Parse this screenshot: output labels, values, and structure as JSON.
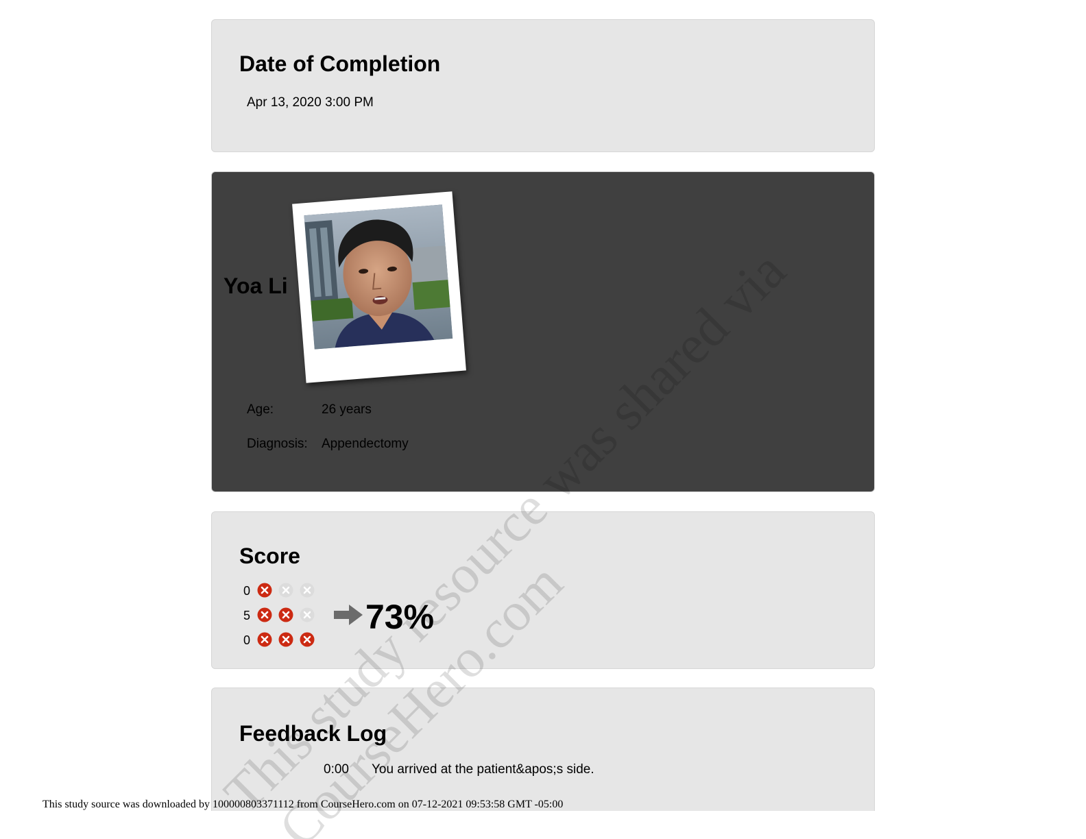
{
  "completion": {
    "title": "Date of Completion",
    "date": "Apr 13, 2020 3:00 PM"
  },
  "patient": {
    "name": "Yoa Li",
    "age_label": "Age:",
    "age_value": "26 years",
    "diagnosis_label": "Diagnosis:",
    "diagnosis_value": "Appendectomy"
  },
  "score": {
    "title": "Score",
    "rows": [
      {
        "count": "0",
        "marks_active": 1,
        "marks_total": 3
      },
      {
        "count": "5",
        "marks_active": 2,
        "marks_total": 3
      },
      {
        "count": "0",
        "marks_active": 3,
        "marks_total": 3
      }
    ],
    "percent": "73%",
    "colors": {
      "active": "#cc2a12",
      "inactive": "#dcdcdc",
      "arrow": "#6b6b6b"
    }
  },
  "feedback_log": {
    "title": "Feedback Log",
    "entries": [
      {
        "time": "0:00",
        "text": "You arrived at the patient&apos;s side."
      }
    ]
  },
  "watermark": {
    "line1": "This study resource was shared via",
    "line2": "CourseHero.com"
  },
  "footer": {
    "note": "This study source was downloaded by 100000803371112 from CourseHero.com on 07-12-2021 09:53:58 GMT -05:00"
  }
}
